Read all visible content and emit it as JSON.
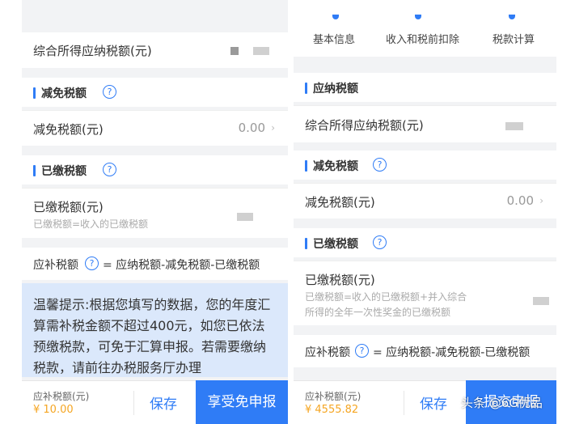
{
  "left": {
    "top_row": {
      "label": "综合所得应纳税额(元)"
    },
    "reduction": {
      "title": "减免税额",
      "help": "?",
      "row_label": "减免税额(元)",
      "row_value": "0.00",
      "chevron": "›"
    },
    "paid": {
      "title": "已缴税额",
      "help": "?",
      "row_label": "已缴税额(元)",
      "row_sub": "已缴税额=收入的已缴税额"
    },
    "formula": {
      "label": "应补税额",
      "help": "?",
      "expr": "= 应纳税额-减免税额-已缴税额"
    },
    "tip": {
      "text": "温馨提示:根据您填写的数据，您的年度汇算需补税金额不超过400元，如您已依法预缴税款，可免于汇算申报。若需要缴纳税款，请前往办税服务厅办理"
    },
    "bottom": {
      "label": "应补税额(元)",
      "amount": "¥ 10.00",
      "save": "保存",
      "primary": "享受免申报"
    }
  },
  "right": {
    "tabs": [
      "基本信息",
      "收入和税前扣除",
      "税款计算"
    ],
    "payable": {
      "title": "应纳税额",
      "row_label": "综合所得应纳税额(元)"
    },
    "reduction": {
      "title": "减免税额",
      "help": "?",
      "row_label": "减免税额(元)",
      "row_value": "0.00",
      "chevron": "›"
    },
    "paid": {
      "title": "已缴税额",
      "help": "?",
      "row_label": "已缴税额(元)",
      "row_sub_1": "已缴税额=收入的已缴税额+并入综合",
      "row_sub_2": "所得的全年一次性奖金的已缴税额"
    },
    "formula": {
      "label": "应补税额",
      "help": "?",
      "expr": "= 应纳税额-减免税额-已缴税额"
    },
    "bottom": {
      "label": "应补税额(元)",
      "amount": "¥ 4555.82",
      "save": "保存",
      "primary": "提交申报"
    }
  },
  "watermark": "头条 @6G优品",
  "colors": {
    "accent": "#2f7cf6",
    "tip_bg": "#dbe8fb",
    "amount": "#f5a623"
  }
}
